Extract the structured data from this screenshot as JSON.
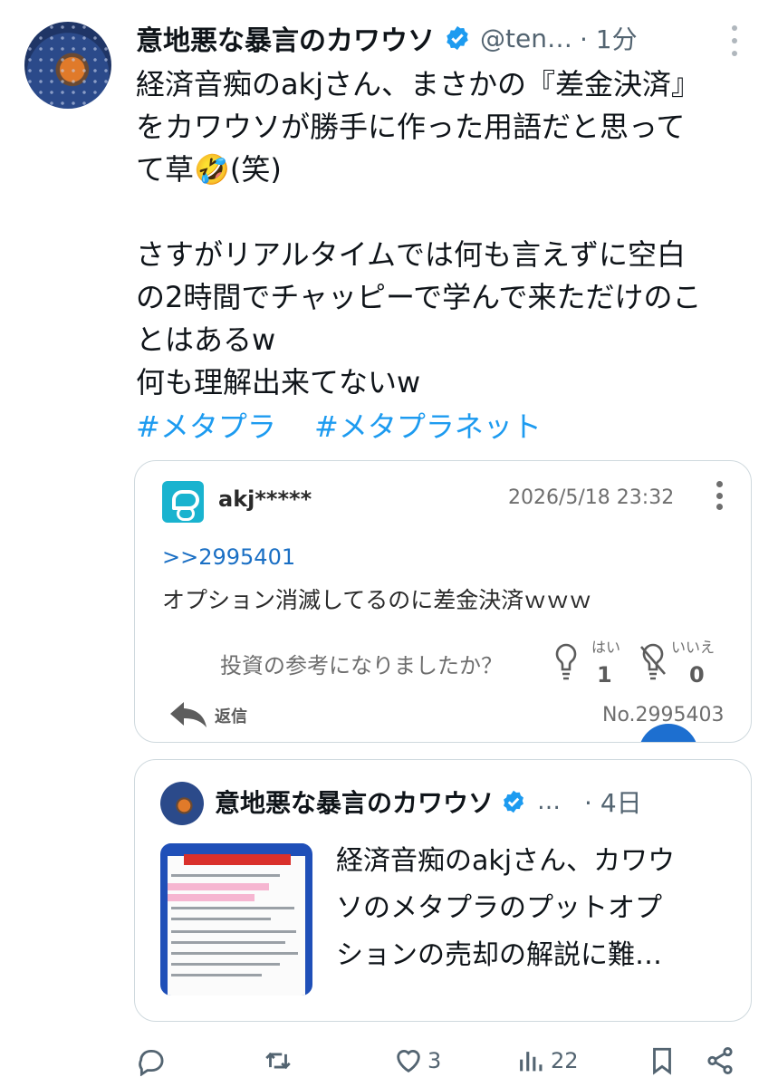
{
  "tweet": {
    "display_name": "意地悪な暴言のカワウソ",
    "handle": "@ten…",
    "time": "· 1分",
    "body_lines": [
      "経済音痴のakjさん、まさかの『差金決済』",
      "をカワウソが勝手に作った用語だと思って",
      "て草🤣(笑)",
      "",
      "さすがリアルタイムでは何も言えずに空白",
      "の2時間でチャッピーで学んで来ただけのこ",
      "とはあるw",
      "何も理解出来てないw"
    ],
    "hashtags": [
      "#メタプラ",
      "#メタプラネット"
    ]
  },
  "embed": {
    "username": "akj*****",
    "date": "2026/5/18 23:32",
    "reference": ">>2995401",
    "message": "オプション消滅してるのに差金決済ｗｗｗ",
    "question": "投資の参考になりましたか？",
    "yes_label": "はい",
    "yes_count": "1",
    "no_label": "いいえ",
    "no_count": "0",
    "reply_label": "返信",
    "post_number": "No.2995403"
  },
  "quoted": {
    "display_name": "意地悪な暴言のカワウソ",
    "ellipsis": "…",
    "time": "· 4日",
    "text_lines": [
      "経済音痴のakjさん、カワウ",
      "ソのメタプラのプットオプ",
      "ションの売却の解説に難…"
    ]
  },
  "actions": {
    "like_count": "3",
    "view_count": "22"
  },
  "colors": {
    "accent": "#1d9bf0",
    "verified": "#1d9bf0",
    "secondary_text": "#536471"
  },
  "icons": [
    "verified-badge-icon",
    "more-icon",
    "bulb-icon",
    "bulb-off-icon",
    "reply-icon",
    "comment-icon",
    "retweet-icon",
    "like-icon",
    "views-icon",
    "bookmark-icon",
    "share-icon"
  ]
}
